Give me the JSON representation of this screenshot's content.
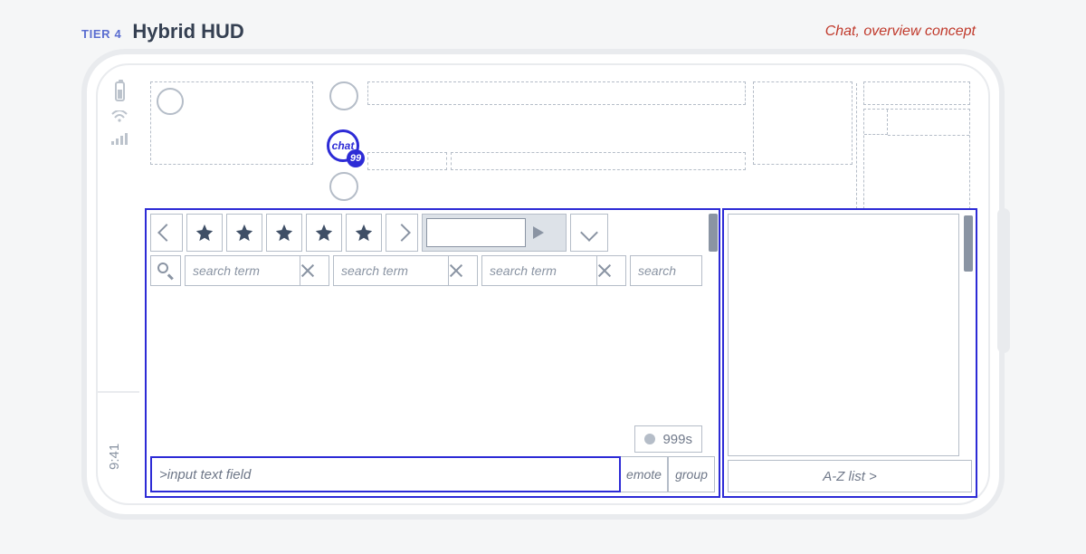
{
  "header": {
    "tier": "TIER 4",
    "title": "Hybrid HUD",
    "concept": "Chat, overview concept"
  },
  "status": {
    "time": "9:41"
  },
  "chat_icon": {
    "label": "chat",
    "badge": "99"
  },
  "toolbar": {
    "star_count": 5
  },
  "search": {
    "placeholder": "search term",
    "extra_placeholder": "search",
    "terms": [
      {
        "text": "search term"
      },
      {
        "text": "search term"
      },
      {
        "text": "search term"
      }
    ]
  },
  "timer": {
    "value": "999s"
  },
  "input": {
    "placeholder": ">input text field",
    "emote": "emote",
    "group": "group"
  },
  "right": {
    "list_label": "A-Z list >"
  }
}
